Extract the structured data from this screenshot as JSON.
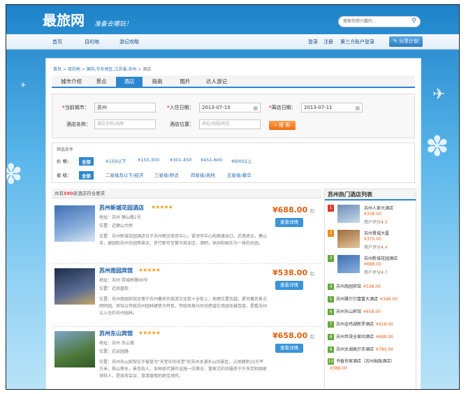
{
  "header": {
    "logo": "最旅网",
    "slogan": "准备去哪玩！",
    "search_placeholder": "搜索你感兴趣的..."
  },
  "nav": {
    "items": [
      "首页",
      "目的地",
      "游记攻略"
    ],
    "login": "登录",
    "register": "注册",
    "third": "第三方账户登录",
    "share": "分享计划"
  },
  "breadcrumb": {
    "home": "首页",
    "dest": "目的地",
    "region": "国内,华东地区,江苏省,苏州",
    "current": "酒店"
  },
  "tabs": [
    "城市介绍",
    "景点",
    "酒店",
    "指南",
    "图片",
    "达人游记"
  ],
  "form": {
    "city_label": "当前城市：",
    "city": "苏州",
    "checkin_label": "入住日期：",
    "checkin": "2013-07-10",
    "checkout_label": "离店日期：",
    "checkout": "2013-07-11",
    "name_label": "酒店名称：",
    "name_ph": "酒店名称/品牌",
    "pos_label": "酒店位置：",
    "pos_ph": "地址/商圈/附近",
    "search_btn": "搜 索"
  },
  "filter": {
    "title": "筛选条件",
    "price_label": "价  格：",
    "prices": [
      "全部",
      "¥150以下",
      "¥150-300",
      "¥301-450",
      "¥451-600",
      "¥600以上"
    ],
    "star_label": "星  级：",
    "stars": [
      "全部",
      "二星级及以下/经济",
      "三星级/舒适",
      "四星级/高档",
      "五星级/豪华"
    ]
  },
  "count": {
    "pre": "共有",
    "num": "590",
    "post": "家酒店符合要求"
  },
  "hotels": [
    {
      "name": "苏州新城花园酒店",
      "stars": "★★★★★",
      "addr": "地址：苏州 狮山路1号",
      "area": "位置：迈狮山大桥",
      "desc": "位置：苏州新城花园酒店位于苏州新区商贸中心，紧邻市中心和高速出口，近塔虎丘，寒山寺，留园和苏州乐园等景点，步行即可至繁华商业区，酒吧，休闲和娱乐为一体的乐园。",
      "price": "¥688.00",
      "unit": "起",
      "btn": "查看详情"
    },
    {
      "name": "苏州南园宾馆",
      "stars": "★★★★★",
      "addr": "地址：苏州 带城桥路99号",
      "area": "位置：近凤凰街",
      "desc": "位置：苏州南园宾馆坐落于苏州著名的旅游文化街十全街上，地理位置优越，紧邻著名景点网师园。宾馆以传统苏州园林建筑为特色，传统风格与时尚感谐在南园无缝连接，是看苏州以入住的苏州园林。",
      "price": "¥538.00",
      "unit": "起",
      "btn": "查看详情"
    },
    {
      "name": "苏州东山宾馆",
      "stars": "★★★★★",
      "addr": "地址：苏州 东山镇",
      "area": "位置：近启园路",
      "desc": "位置：苏州东山宾馆位于被誉为\"天堂中的天堂\"的苏州太湖东山风景区，占地面积20万平方米，依山傍水，景色怡人，各种现代操作设施一应俱全，管家式的功服务于许多党和国家领导人，是商务会议，旅游度假的绝佳场所。",
      "price": "¥658.00",
      "unit": "起",
      "btn": "查看详情"
    }
  ],
  "side": {
    "title": "苏州热门酒店列表",
    "top": [
      {
        "rank": "1",
        "name": "苏州人家大酒店",
        "price": "¥338.00",
        "score_label": "用户评分",
        "score": "4.3"
      },
      {
        "rank": "2",
        "name": "苏州晋城大厦",
        "price": "¥375.00",
        "score_label": "用户评分",
        "score": "4.4"
      },
      {
        "rank": "3",
        "name": "苏州新城花园酒店",
        "price": "¥688.00",
        "score_label": "用户评分",
        "score": "4.7"
      }
    ],
    "rest": [
      {
        "rank": "4",
        "name": "苏州南园宾馆",
        "price": "¥538.00"
      },
      {
        "rank": "5",
        "name": "苏州雅尔尔富富大酒店",
        "price": "¥348.00"
      },
      {
        "rank": "6",
        "name": "苏州东山宾馆",
        "price": "¥658.00"
      },
      {
        "rank": "7",
        "name": "苏州金鸡湖新罗酒店",
        "price": "¥918.00"
      },
      {
        "rank": "8",
        "name": "苏州世茂全家间酒店",
        "price": "¥688.00"
      },
      {
        "rank": "9",
        "name": "苏州太湖高尔夫酒店",
        "price": "¥780.00"
      },
      {
        "rank": "10",
        "name": "书香世家酒店（苏州拙政酒店）",
        "price": "¥388.00"
      }
    ]
  }
}
